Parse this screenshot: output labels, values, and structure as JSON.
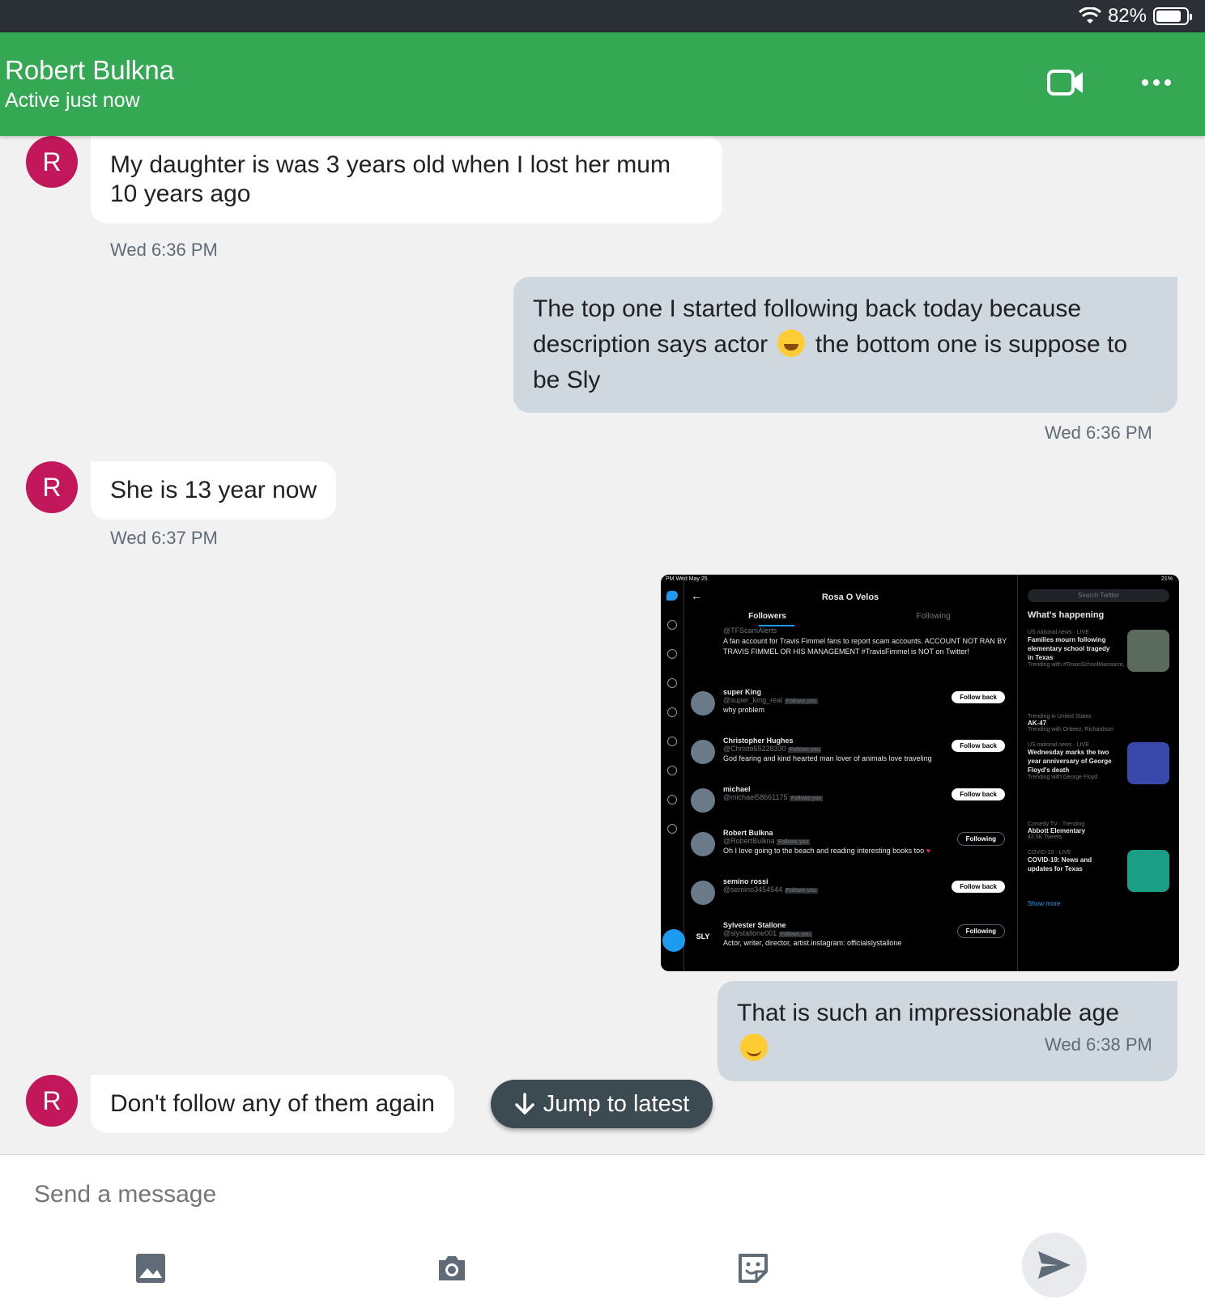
{
  "status_bar": {
    "battery": "82%",
    "battery_level": 0.82
  },
  "header": {
    "title": "Robert Bulkna",
    "subtitle": "Active just now",
    "video_icon": "video-camera-icon",
    "more_icon": "more-horizontal-icon"
  },
  "messages": [
    {
      "from": "them",
      "avatar": "R",
      "text": "My daughter is was 3 years old when I lost her mum 10 years ago",
      "time": "Wed 6:36 PM"
    },
    {
      "from": "me",
      "text_a": "The top one I started following back today because description says actor",
      "text_b": "the bottom one is suppose to be Sly",
      "emoji": "tears-of-joy",
      "time": "Wed 6:36 PM"
    },
    {
      "from": "them",
      "avatar": "R",
      "text": "She is 13 year now",
      "time": "Wed 6:37 PM"
    },
    {
      "from": "me",
      "text": "That is such an impressionable age",
      "emoji": "smiling-face",
      "time": "Wed 6:38 PM"
    },
    {
      "from": "them",
      "avatar": "R",
      "text": "Don't follow any of them again"
    }
  ],
  "screenshot": {
    "status_left": "PM  Wed May 25",
    "status_right": "21%",
    "profile_name": "Rosa O Velos",
    "tabs": [
      "Followers",
      "Following"
    ],
    "search_placeholder": "Search Twitter",
    "users": [
      {
        "name": "",
        "handle": "@TFScamAlerts",
        "badge": "Follows you",
        "bio": "A fan account for Travis Fimmel fans to report scam accounts. ACCOUNT NOT RAN BY TRAVIS FIMMEL OR HIS MANAGEMENT #TravisFimmel is NOT on Twitter!",
        "button": ""
      },
      {
        "name": "super King",
        "handle": "@super_king_real",
        "badge": "Follows you",
        "bio": "why problem",
        "button": "Follow back"
      },
      {
        "name": "Christopher Hughes",
        "handle": "@Christo55228330",
        "badge": "Follows you",
        "bio": "God fearing and kind hearted man lover of animals love traveling",
        "button": "Follow back"
      },
      {
        "name": "michael",
        "handle": "@michael58661175",
        "badge": "Follows you",
        "bio": "",
        "button": "Follow back"
      },
      {
        "name": "Robert Bulkna",
        "handle": "@RobertBulkna",
        "badge": "Follows you",
        "bio": "Oh I love going to the beach and reading interesting books too",
        "button": "Following"
      },
      {
        "name": "semino rossi",
        "handle": "@semino3454544",
        "badge": "Follows you",
        "bio": "",
        "button": "Follow back"
      },
      {
        "name": "Sylvester Stallone",
        "handle": "@slystallone001",
        "badge": "Follows you",
        "bio": "Actor, writer, director, artist.instagram: officialslystallone",
        "button": "Following"
      }
    ],
    "whats_happening": "What's happening",
    "trends": [
      {
        "meta": "US national news · LIVE",
        "title": "Families mourn following elementary school tragedy in Texas",
        "sub": "Trending with #TexasSchoolMassacre,"
      },
      {
        "meta": "Trending in United States",
        "title": "AK-47",
        "sub": "Trending with Orbeez, Richardson"
      },
      {
        "meta": "US national news · LIVE",
        "title": "Wednesday marks the two year anniversary of George Floyd's death",
        "sub": "Trending with George Floyd"
      },
      {
        "meta": "Comedy TV · Trending",
        "title": "Abbott Elementary",
        "sub": "42.5K Tweets"
      },
      {
        "meta": "COVID-19 · LIVE",
        "title": "COVID-19: News and updates for Texas",
        "sub": ""
      }
    ],
    "show_more": "Show more"
  },
  "jump_to_latest": "Jump to latest",
  "composer": {
    "placeholder": "Send a message"
  },
  "colors": {
    "header": "#34a853",
    "avatar": "#c2185b",
    "outgoing_bubble": "#cfd8df",
    "incoming_bubble": "#ffffff"
  }
}
